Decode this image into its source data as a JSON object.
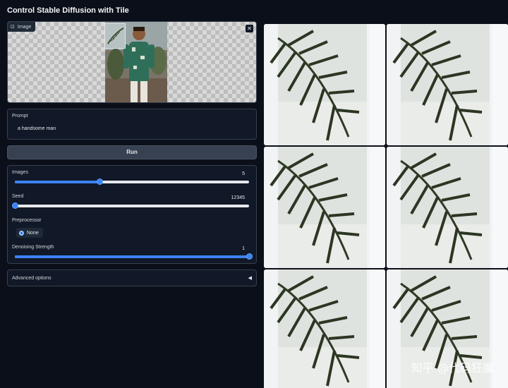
{
  "app": {
    "title": "Control Stable Diffusion with Tile"
  },
  "image_input": {
    "label": "Image",
    "close_icon": "close-icon"
  },
  "prompt": {
    "label": "Prompt",
    "value": "a handsome man"
  },
  "run_button": {
    "label": "Run"
  },
  "controls": {
    "images": {
      "label": "Images",
      "value": "5",
      "fraction": 0.36
    },
    "seed": {
      "label": "Seed",
      "value": "12345",
      "fraction": 0.0
    },
    "preprocessor": {
      "label": "Preprocessor",
      "option": "None"
    },
    "denoising": {
      "label": "Denoising Strength",
      "value": "1",
      "fraction": 1.0
    }
  },
  "advanced": {
    "label": "Advanced options",
    "arrow": "◀"
  },
  "watermark": "知乎 @代码狂魔",
  "colors": {
    "accent": "#3b82f6",
    "background": "#0b0f19",
    "panel": "#111827"
  }
}
